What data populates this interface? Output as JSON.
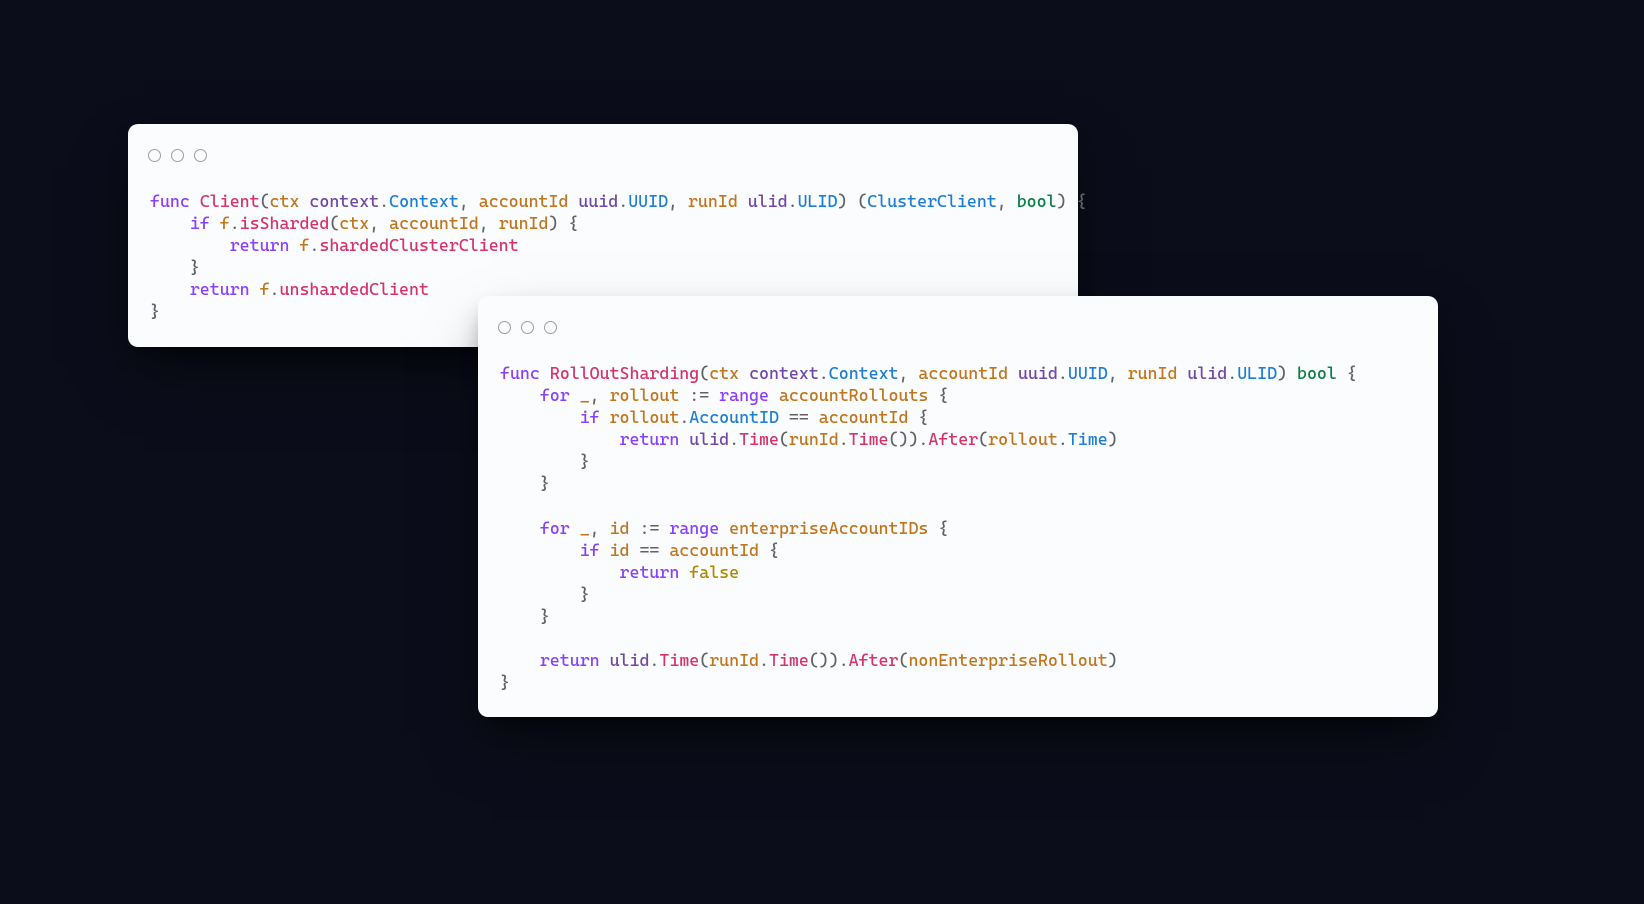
{
  "card1": {
    "line1": {
      "kw_func": "func",
      "fn": "Client",
      "lp1": "(",
      "ctx": "ctx",
      "pkg_context": "context",
      "dot1": ".",
      "typ_Context": "Context",
      "c1": ", ",
      "accountId": "accountId",
      "pkg_uuid": "uuid",
      "dot2": ".",
      "typ_UUID": "UUID",
      "c2": ", ",
      "runId": "runId",
      "pkg_ulid": "ulid",
      "dot3": ".",
      "typ_ULID": "ULID",
      "rp1": ") (",
      "typ_ClusterClient": "ClusterClient",
      "c3": ", ",
      "typ_bool": "bool",
      "rp2": ") {"
    },
    "line2": {
      "kw_if": "if",
      "f": "f",
      "dot": ".",
      "fn_isSharded": "isSharded",
      "lp": "(",
      "ctx": "ctx",
      "c1": ", ",
      "accountId": "accountId",
      "c2": ", ",
      "runId": "runId",
      "rp": ") {"
    },
    "line3": {
      "kw_return": "return",
      "f": "f",
      "dot": ".",
      "field": "shardedClusterClient"
    },
    "line4": {
      "close": "}"
    },
    "line5": {
      "kw_return": "return",
      "f": "f",
      "dot": ".",
      "field": "unshardedClient"
    },
    "line6": {
      "close": "}"
    }
  },
  "card2": {
    "l1": {
      "kw_func": "func",
      "fn": "RollOutSharding",
      "lp": "(",
      "ctx": "ctx",
      "pkg_context": "context",
      "d1": ".",
      "typ_Context": "Context",
      "c1": ", ",
      "accountId": "accountId",
      "pkg_uuid": "uuid",
      "d2": ".",
      "typ_UUID": "UUID",
      "c2": ", ",
      "runId": "runId",
      "pkg_ulid": "ulid",
      "d3": ".",
      "typ_ULID": "ULID",
      "rp": ") ",
      "ret": "bool",
      "brace": " {"
    },
    "l2": {
      "kw_for": "for",
      "us": "_",
      "c": ", ",
      "rollout": "rollout",
      "assign": " := ",
      "kw_range": "range",
      "accountRollouts": "accountRollouts",
      "brace": " {"
    },
    "l3": {
      "kw_if": "if",
      "rollout": "rollout",
      "d": ".",
      "AccountID": "AccountID",
      "eq": " == ",
      "accountId": "accountId",
      "brace": " {"
    },
    "l4": {
      "kw_return": "return",
      "pkg_ulid": "ulid",
      "d1": ".",
      "fn_Time": "Time",
      "lp1": "(",
      "runId": "runId",
      "d2": ".",
      "fn_Time2": "Time",
      "paren": "()",
      "rp1": ").",
      "fn_After": "After",
      "lp2": "(",
      "rollout": "rollout",
      "d3": ".",
      "Time": "Time",
      "rp2": ")"
    },
    "l5": {
      "close": "}"
    },
    "l6": {
      "close": "}"
    },
    "l7": {
      "kw_for": "for",
      "us": "_",
      "c": ", ",
      "id": "id",
      "assign": " := ",
      "kw_range": "range",
      "enterpriseAccountIDs": "enterpriseAccountIDs",
      "brace": " {"
    },
    "l8": {
      "kw_if": "if",
      "id": "id",
      "eq": " == ",
      "accountId": "accountId",
      "brace": " {"
    },
    "l9": {
      "kw_return": "return",
      "lit_false": "false"
    },
    "l10": {
      "close": "}"
    },
    "l11": {
      "close": "}"
    },
    "l12": {
      "kw_return": "return",
      "pkg_ulid": "ulid",
      "d1": ".",
      "fn_Time": "Time",
      "lp1": "(",
      "runId": "runId",
      "d2": ".",
      "fn_Time2": "Time",
      "paren": "()",
      "rp1": ").",
      "fn_After": "After",
      "lp2": "(",
      "nonEnterpriseRollout": "nonEnterpriseRollout",
      "rp2": ")"
    },
    "l13": {
      "close": "}"
    }
  }
}
